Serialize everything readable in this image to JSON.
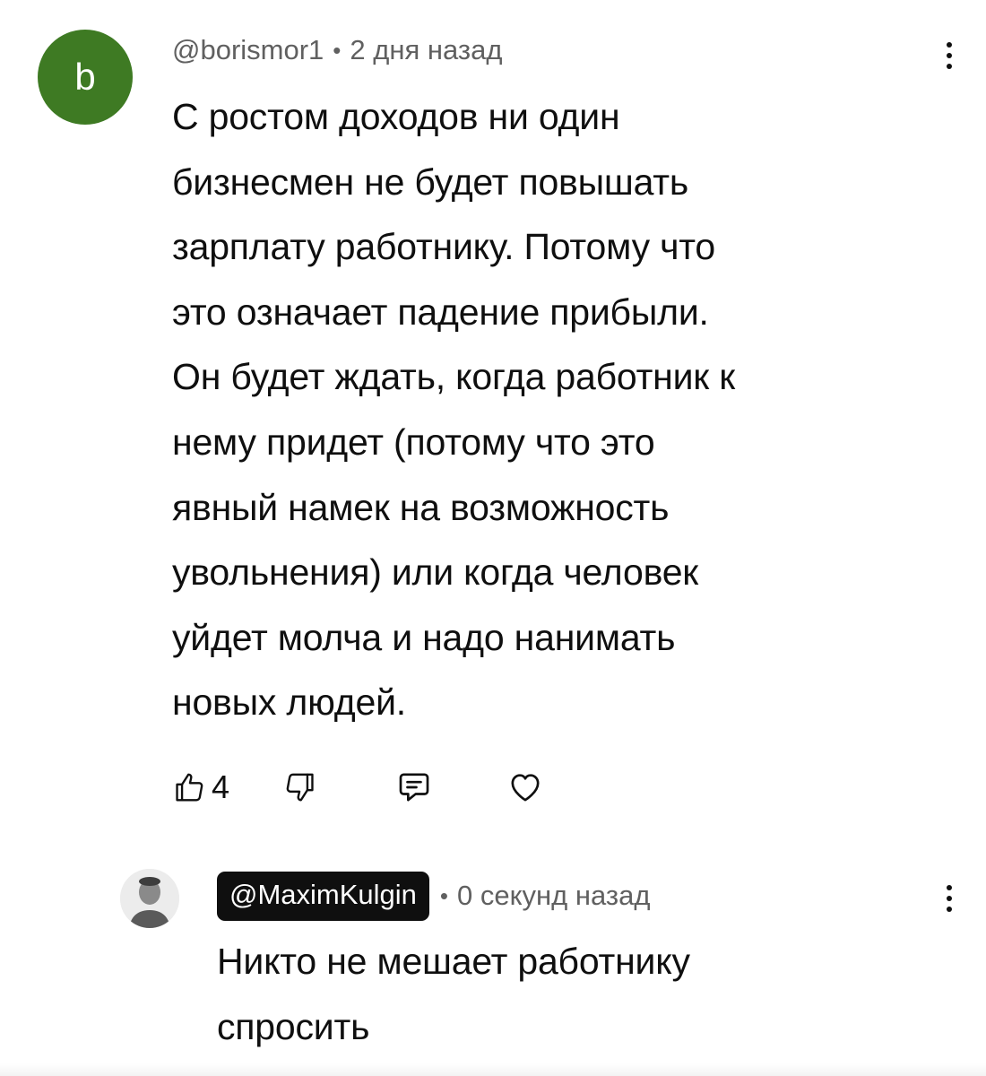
{
  "top_comment": {
    "avatar_letter": "b",
    "avatar_color": "#3e7a23",
    "handle": "@borismor1",
    "separator": "•",
    "time": "2 дня назад",
    "body_lines": [
      "С ростом доходов ни один",
      "бизнесмен не будет повышать",
      "зарплату работнику. Потому что",
      "это означает падение прибыли.",
      "Он будет ждать, когда работник к",
      "нему придет (потому что это",
      "явный намек на возможность",
      "увольнения) или когда человек",
      "уйдет молча и надо нанимать",
      "новых людей."
    ],
    "like_count": "4",
    "icons": [
      "thumbs-up-icon",
      "thumbs-down-icon",
      "reply-icon",
      "heart-icon",
      "more-vert-icon"
    ]
  },
  "reply": {
    "handle": "@MaximKulgin",
    "separator": "•",
    "time": "0 секунд назад",
    "body_lines": [
      "Никто не мешает работнику",
      "спросить"
    ],
    "icons": [
      "avatar-photo",
      "more-vert-icon"
    ]
  }
}
